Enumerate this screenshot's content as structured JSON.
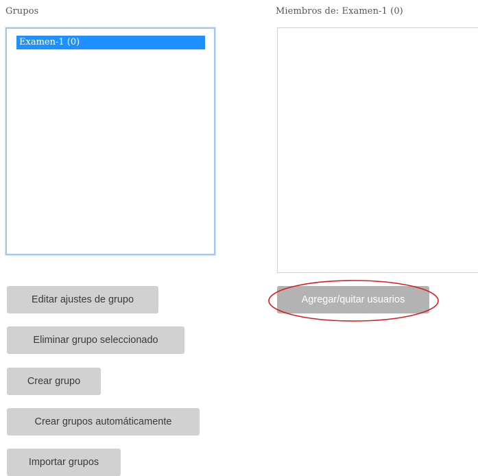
{
  "groups_panel": {
    "label": "Grupos",
    "options": [
      {
        "label": "Examen-1 (0)",
        "selected": true
      }
    ]
  },
  "members_panel": {
    "label": "Miembros de: Examen-1 (0)",
    "members": []
  },
  "buttons": {
    "edit_settings": "Editar ajustes de grupo",
    "delete_group": "Eliminar grupo seleccionado",
    "create_group": "Crear grupo",
    "auto_create": "Crear grupos automáticamente",
    "import_groups": "Importar grupos",
    "add_remove_users": "Agregar/quitar usuarios"
  },
  "annotation": {
    "shape": "ellipse",
    "color": "#d81c1c",
    "target": "add_remove_users"
  },
  "colors": {
    "selection": "#1e90ff",
    "button_bg": "#d1d1d1",
    "button_disabled_bg": "#b3b3b3",
    "listbox_focus_border": "#a6c6f0"
  }
}
